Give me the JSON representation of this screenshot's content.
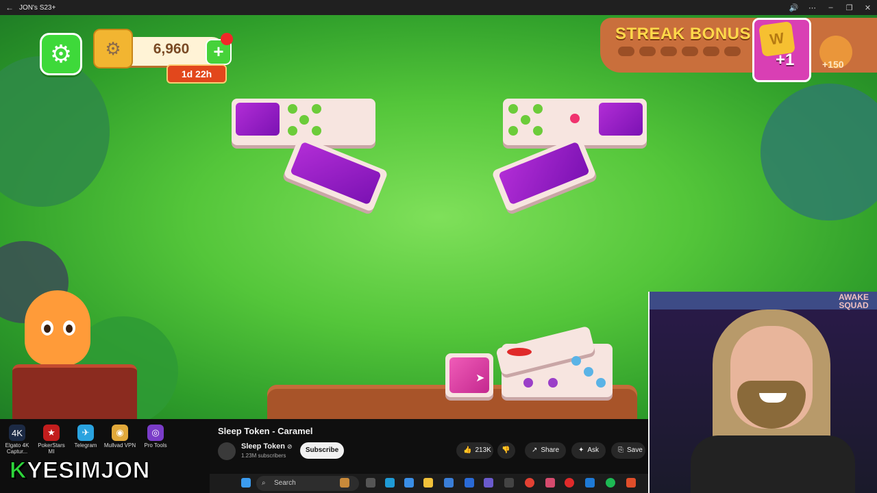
{
  "window": {
    "title": "JON's S23+",
    "back": "←",
    "controls": [
      "🔊",
      "⋯",
      "–",
      "❐",
      "✕"
    ]
  },
  "hud": {
    "coins": "6,960",
    "plus": "+",
    "timer": "1d 22h",
    "settings_icon": "⚙",
    "coin_icon": "⚙"
  },
  "streak": {
    "title": "STREAK BONUS",
    "badge_letter": "W",
    "badge_bonus": "+1",
    "reward": "+150"
  },
  "dock": {
    "items": [
      {
        "label": "Elgato 4K Captur...",
        "icon": "4K",
        "color": "#1c2a44"
      },
      {
        "label": "PokerStars MI",
        "icon": "★",
        "color": "#c21d1d"
      },
      {
        "label": "Telegram",
        "icon": "✈",
        "color": "#2aa3df"
      },
      {
        "label": "Mullvad VPN",
        "icon": "◉",
        "color": "#e1a83a"
      },
      {
        "label": "Pro Tools",
        "icon": "◎",
        "color": "#7a3cc8"
      }
    ]
  },
  "brand": {
    "k": "K",
    "rest": "YESIMJON"
  },
  "youtube": {
    "title": "Sleep Token - Caramel",
    "channel": "Sleep Token",
    "verified": "⊘",
    "subscribers": "1.23M subscribers",
    "subscribe": "Subscribe",
    "likes": "213K",
    "share": "Share",
    "ask": "Ask",
    "save": "Save"
  },
  "taskbar": {
    "search": "Search"
  },
  "webcam": {
    "poster_text": "AWAKE SQUAD"
  },
  "colors": {
    "game_green": "#54c63a",
    "purple": "#9a1fc8",
    "hud_orange": "#c96f3c"
  }
}
